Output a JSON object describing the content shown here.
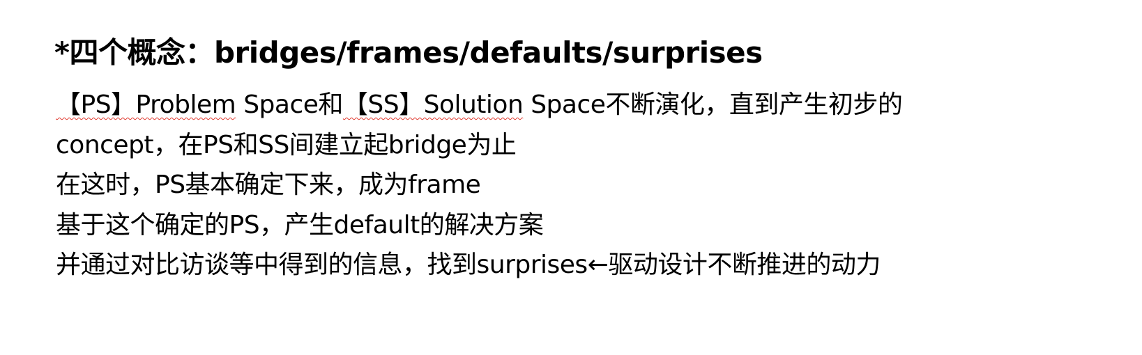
{
  "document": {
    "heading": "*四个概念：bridges/frames/defaults/surprises",
    "line1": {
      "ps_label": "【PS】Problem",
      "ps_space": " Space和",
      "ss_label": "【SS】Solution",
      "rest": " Space不断演化，直到产生初步的"
    },
    "lines": [
      "concept，在PS和SS间建立起bridge为止",
      "在这时，PS基本确定下来，成为frame",
      "基于这个确定的PS，产生default的解决方案",
      "并通过对比访谈等中得到的信息，找到surprises←驱动设计不断推进的动力"
    ]
  }
}
